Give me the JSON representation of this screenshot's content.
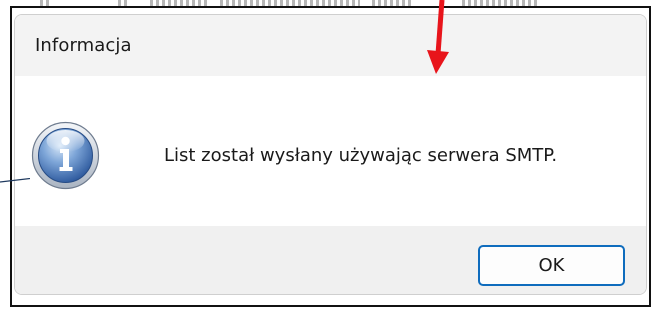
{
  "dialog": {
    "title": "Informacja",
    "message": "List został wysłany używając serwera SMTP.",
    "ok_label": "OK",
    "icon": "information-icon"
  },
  "annotations": {
    "arrow_color": "#e8141b",
    "pointer_line_color": "#1f3a5f"
  },
  "colors": {
    "titlebar_bg": "#f3f3f3",
    "footer_bg": "#f0f0f0",
    "button_border": "#0f6cbd"
  }
}
